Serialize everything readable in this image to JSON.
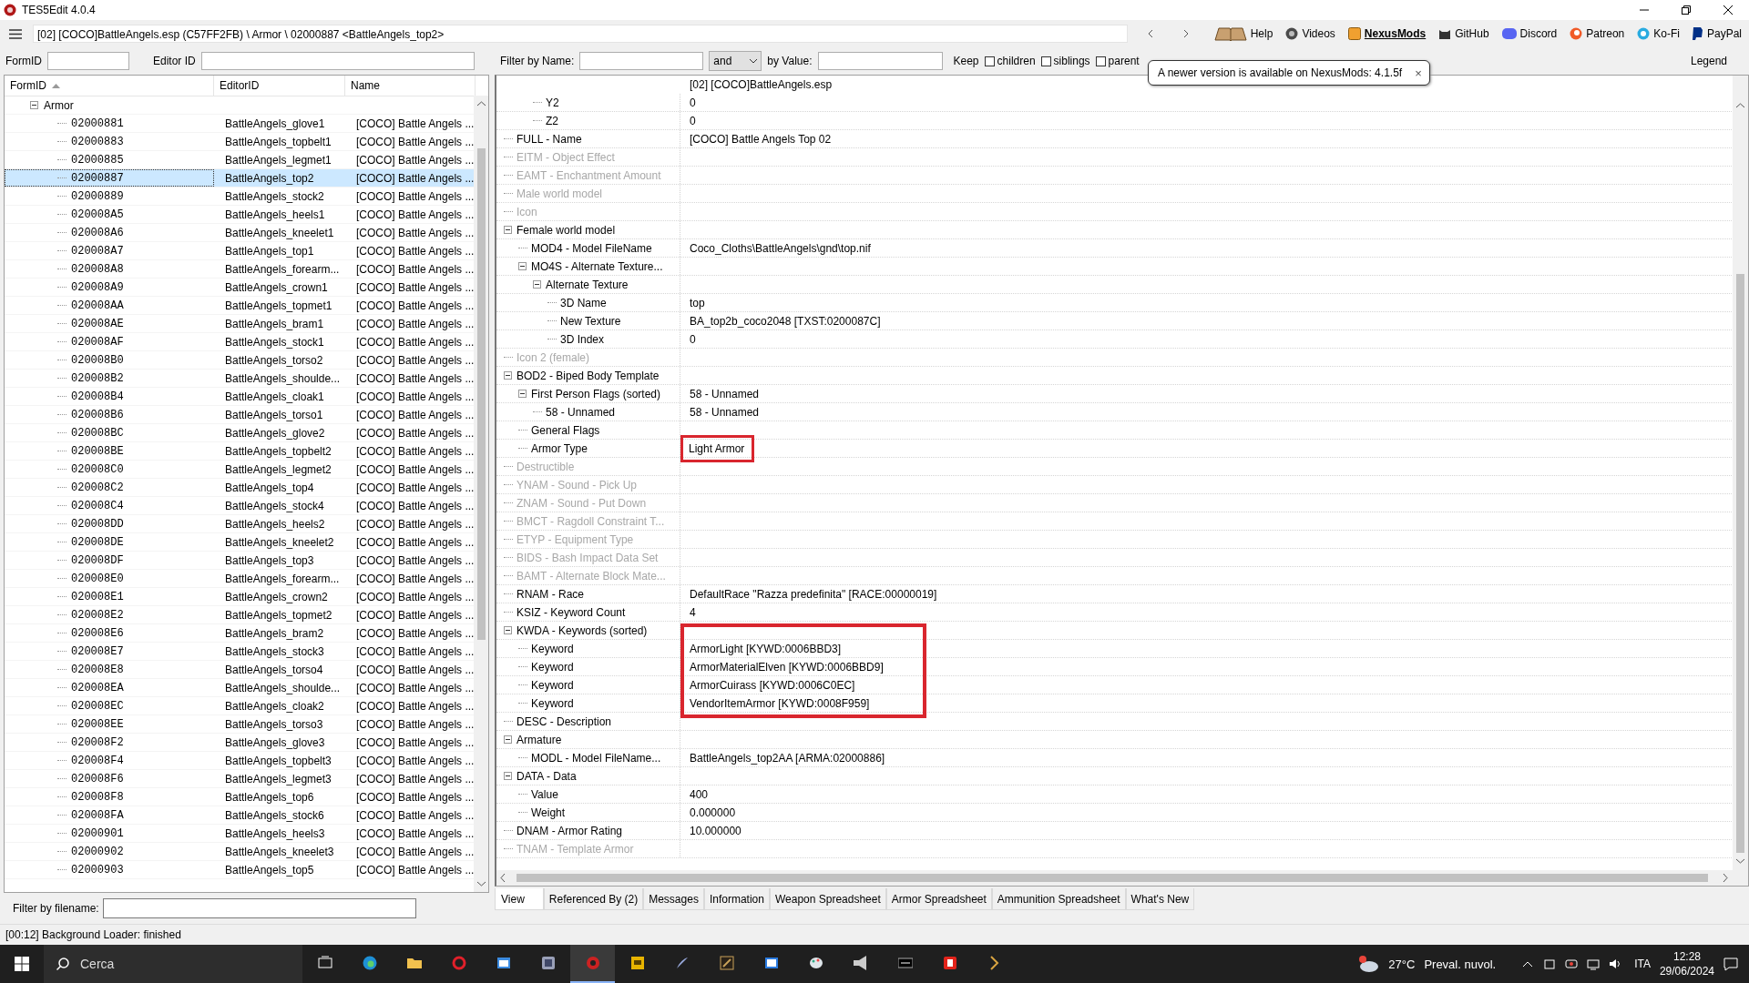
{
  "window": {
    "title": "TES5Edit 4.0.4"
  },
  "navbar": {
    "path": "[02] [COCO]BattleAngels.esp (C57FF2FB) \\ Armor \\ 02000887 <BattleAngels_top2>",
    "links": [
      {
        "label": "Help",
        "highlighted": false
      },
      {
        "label": "Videos",
        "highlighted": false
      },
      {
        "label": "NexusMods",
        "highlighted": true
      },
      {
        "label": "GitHub",
        "highlighted": false
      },
      {
        "label": "Discord",
        "highlighted": false
      },
      {
        "label": "Patreon",
        "highlighted": false
      },
      {
        "label": "Ko-Fi",
        "highlighted": false
      },
      {
        "label": "PayPal",
        "highlighted": false
      }
    ]
  },
  "left_filter": {
    "formid_label": "FormID",
    "editorid_label": "Editor ID"
  },
  "right_filter": {
    "name_label": "Filter by Name:",
    "operator": "and",
    "value_label": "by Value:",
    "keep_label": "Keep",
    "checkboxes": [
      {
        "label": "children",
        "checked": false
      },
      {
        "label": "siblings",
        "checked": false
      },
      {
        "label": "parent",
        "checked": false
      }
    ],
    "legend": "Legend"
  },
  "notification": {
    "text": "A newer version is available on NexusMods: 4.1.5f",
    "close": "×"
  },
  "records": {
    "columns": [
      "FormID",
      "EditorID",
      "Name"
    ],
    "group": {
      "label": "Armor",
      "expanded": true
    },
    "rows": [
      {
        "form_id": "02000881",
        "editor_id": "BattleAngels_glove1",
        "name": "[COCO] Battle Angels ...",
        "selected": false
      },
      {
        "form_id": "02000883",
        "editor_id": "BattleAngels_topbelt1",
        "name": "[COCO] Battle Angels ...",
        "selected": false
      },
      {
        "form_id": "02000885",
        "editor_id": "BattleAngels_legmet1",
        "name": "[COCO] Battle Angels ...",
        "selected": false
      },
      {
        "form_id": "02000887",
        "editor_id": "BattleAngels_top2",
        "name": "[COCO] Battle Angels ...",
        "selected": true
      },
      {
        "form_id": "02000889",
        "editor_id": "BattleAngels_stock2",
        "name": "[COCO] Battle Angels ...",
        "selected": false
      },
      {
        "form_id": "020008A5",
        "editor_id": "BattleAngels_heels1",
        "name": "[COCO] Battle Angels ...",
        "selected": false
      },
      {
        "form_id": "020008A6",
        "editor_id": "BattleAngels_kneelet1",
        "name": "[COCO] Battle Angels ...",
        "selected": false
      },
      {
        "form_id": "020008A7",
        "editor_id": "BattleAngels_top1",
        "name": "[COCO] Battle Angels ...",
        "selected": false
      },
      {
        "form_id": "020008A8",
        "editor_id": "BattleAngels_forearm...",
        "name": "[COCO] Battle Angels ...",
        "selected": false
      },
      {
        "form_id": "020008A9",
        "editor_id": "BattleAngels_crown1",
        "name": "[COCO] Battle Angels ...",
        "selected": false
      },
      {
        "form_id": "020008AA",
        "editor_id": "BattleAngels_topmet1",
        "name": "[COCO] Battle Angels ...",
        "selected": false
      },
      {
        "form_id": "020008AE",
        "editor_id": "BattleAngels_bram1",
        "name": "[COCO] Battle Angels ...",
        "selected": false
      },
      {
        "form_id": "020008AF",
        "editor_id": "BattleAngels_stock1",
        "name": "[COCO] Battle Angels ...",
        "selected": false
      },
      {
        "form_id": "020008B0",
        "editor_id": "BattleAngels_torso2",
        "name": "[COCO] Battle Angels ...",
        "selected": false
      },
      {
        "form_id": "020008B2",
        "editor_id": "BattleAngels_shoulde...",
        "name": "[COCO] Battle Angels ...",
        "selected": false
      },
      {
        "form_id": "020008B4",
        "editor_id": "BattleAngels_cloak1",
        "name": "[COCO] Battle Angels ...",
        "selected": false
      },
      {
        "form_id": "020008B6",
        "editor_id": "BattleAngels_torso1",
        "name": "[COCO] Battle Angels ...",
        "selected": false
      },
      {
        "form_id": "020008BC",
        "editor_id": "BattleAngels_glove2",
        "name": "[COCO] Battle Angels ...",
        "selected": false
      },
      {
        "form_id": "020008BE",
        "editor_id": "BattleAngels_topbelt2",
        "name": "[COCO] Battle Angels ...",
        "selected": false
      },
      {
        "form_id": "020008C0",
        "editor_id": "BattleAngels_legmet2",
        "name": "[COCO] Battle Angels ...",
        "selected": false
      },
      {
        "form_id": "020008C2",
        "editor_id": "BattleAngels_top4",
        "name": "[COCO] Battle Angels ...",
        "selected": false
      },
      {
        "form_id": "020008C4",
        "editor_id": "BattleAngels_stock4",
        "name": "[COCO] Battle Angels ...",
        "selected": false
      },
      {
        "form_id": "020008DD",
        "editor_id": "BattleAngels_heels2",
        "name": "[COCO] Battle Angels ...",
        "selected": false
      },
      {
        "form_id": "020008DE",
        "editor_id": "BattleAngels_kneelet2",
        "name": "[COCO] Battle Angels ...",
        "selected": false
      },
      {
        "form_id": "020008DF",
        "editor_id": "BattleAngels_top3",
        "name": "[COCO] Battle Angels ...",
        "selected": false
      },
      {
        "form_id": "020008E0",
        "editor_id": "BattleAngels_forearm...",
        "name": "[COCO] Battle Angels ...",
        "selected": false
      },
      {
        "form_id": "020008E1",
        "editor_id": "BattleAngels_crown2",
        "name": "[COCO] Battle Angels ...",
        "selected": false
      },
      {
        "form_id": "020008E2",
        "editor_id": "BattleAngels_topmet2",
        "name": "[COCO] Battle Angels ...",
        "selected": false
      },
      {
        "form_id": "020008E6",
        "editor_id": "BattleAngels_bram2",
        "name": "[COCO] Battle Angels ...",
        "selected": false
      },
      {
        "form_id": "020008E7",
        "editor_id": "BattleAngels_stock3",
        "name": "[COCO] Battle Angels ...",
        "selected": false
      },
      {
        "form_id": "020008E8",
        "editor_id": "BattleAngels_torso4",
        "name": "[COCO] Battle Angels ...",
        "selected": false
      },
      {
        "form_id": "020008EA",
        "editor_id": "BattleAngels_shoulde...",
        "name": "[COCO] Battle Angels ...",
        "selected": false
      },
      {
        "form_id": "020008EC",
        "editor_id": "BattleAngels_cloak2",
        "name": "[COCO] Battle Angels ...",
        "selected": false
      },
      {
        "form_id": "020008EE",
        "editor_id": "BattleAngels_torso3",
        "name": "[COCO] Battle Angels ...",
        "selected": false
      },
      {
        "form_id": "020008F2",
        "editor_id": "BattleAngels_glove3",
        "name": "[COCO] Battle Angels ...",
        "selected": false
      },
      {
        "form_id": "020008F4",
        "editor_id": "BattleAngels_topbelt3",
        "name": "[COCO] Battle Angels ...",
        "selected": false
      },
      {
        "form_id": "020008F6",
        "editor_id": "BattleAngels_legmet3",
        "name": "[COCO] Battle Angels ...",
        "selected": false
      },
      {
        "form_id": "020008F8",
        "editor_id": "BattleAngels_top6",
        "name": "[COCO] Battle Angels ...",
        "selected": false
      },
      {
        "form_id": "020008FA",
        "editor_id": "BattleAngels_stock6",
        "name": "[COCO] Battle Angels ...",
        "selected": false
      },
      {
        "form_id": "02000901",
        "editor_id": "BattleAngels_heels3",
        "name": "[COCO] Battle Angels ...",
        "selected": false
      },
      {
        "form_id": "02000902",
        "editor_id": "BattleAngels_kneelet3",
        "name": "[COCO] Battle Angels ...",
        "selected": false
      },
      {
        "form_id": "02000903",
        "editor_id": "BattleAngels_top5",
        "name": "[COCO] Battle Angels ...",
        "selected": false
      }
    ],
    "filename_filter_label": "Filter by filename:"
  },
  "record_view": {
    "file_header": "[02] [COCO]BattleAngels.esp",
    "continued_rows": [
      {
        "label": "Y2",
        "value": "0"
      },
      {
        "label": "Z2",
        "value": "0"
      }
    ],
    "fields": [
      {
        "label": "FULL - Name",
        "value": "[COCO] Battle Angels Top 02",
        "disabled": false
      },
      {
        "label": "EITM - Object Effect",
        "disabled": true
      },
      {
        "label": "EAMT - Enchantment Amount",
        "disabled": true
      },
      {
        "label": "Male world model",
        "disabled": true
      },
      {
        "label": "Icon",
        "disabled": true
      },
      {
        "label": "Female world model",
        "disabled": false,
        "expanded": true,
        "children": [
          {
            "label": "MOD4 - Model FileName",
            "value": "Coco_Cloths\\BattleAngels\\gnd\\top.nif",
            "disabled": false
          },
          {
            "label": "MO4S - Alternate Texture...",
            "disabled": false,
            "expanded": true,
            "children": [
              {
                "label": "Alternate Texture",
                "disabled": false,
                "expanded": true,
                "children": [
                  {
                    "label": "3D Name",
                    "value": "top",
                    "disabled": false
                  },
                  {
                    "label": "New Texture",
                    "value": "BA_top2b_coco2048 [TXST:0200087C]",
                    "disabled": false
                  },
                  {
                    "label": "3D Index",
                    "value": "0",
                    "disabled": false
                  }
                ]
              }
            ]
          }
        ]
      },
      {
        "label": "Icon 2 (female)",
        "disabled": true
      },
      {
        "label": "BOD2 - Biped Body Template",
        "disabled": false,
        "expanded": true,
        "children": [
          {
            "label": "First Person Flags (sorted)",
            "value": "58 - Unnamed",
            "disabled": false,
            "expanded": true,
            "children": [
              {
                "label": "58 - Unnamed",
                "value": "58 - Unnamed",
                "disabled": false
              }
            ]
          },
          {
            "label": "General Flags",
            "disabled": false
          },
          {
            "label": "Armor Type",
            "value": "Light Armor",
            "disabled": false,
            "outlined": true
          }
        ]
      },
      {
        "label": "Destructible",
        "disabled": true
      },
      {
        "label": "YNAM - Sound - Pick Up",
        "disabled": true
      },
      {
        "label": "ZNAM - Sound - Put Down",
        "disabled": true
      },
      {
        "label": "BMCT - Ragdoll Constraint T...",
        "disabled": true
      },
      {
        "label": "ETYP - Equipment Type",
        "disabled": true
      },
      {
        "label": "BIDS - Bash Impact Data Set",
        "disabled": true
      },
      {
        "label": "BAMT - Alternate Block Mate...",
        "disabled": true
      },
      {
        "label": "RNAM - Race",
        "value": "DefaultRace \"Razza predefinita\" [RACE:00000019]",
        "disabled": false
      },
      {
        "label": "KSIZ - Keyword Count",
        "value": "4",
        "disabled": false
      },
      {
        "label": "KWDA - Keywords (sorted)",
        "disabled": false,
        "expanded": true,
        "outlined": true,
        "children": [
          {
            "label": "Keyword",
            "value": "ArmorLight [KYWD:0006BBD3]",
            "disabled": false
          },
          {
            "label": "Keyword",
            "value": "ArmorMaterialElven [KYWD:0006BBD9]",
            "disabled": false
          },
          {
            "label": "Keyword",
            "value": "ArmorCuirass [KYWD:0006C0EC]",
            "disabled": false
          },
          {
            "label": "Keyword",
            "value": "VendorItemArmor [KYWD:0008F959]",
            "disabled": false
          }
        ]
      },
      {
        "label": "DESC - Description",
        "disabled": false
      },
      {
        "label": "Armature",
        "disabled": false,
        "expanded": true,
        "children": [
          {
            "label": "MODL - Model FileName...",
            "value": "BattleAngels_top2AA [ARMA:02000886]",
            "disabled": false
          }
        ]
      },
      {
        "label": "DATA - Data",
        "disabled": false,
        "expanded": true,
        "children": [
          {
            "label": "Value",
            "value": "400",
            "disabled": false
          },
          {
            "label": "Weight",
            "value": "0.000000",
            "disabled": false
          }
        ]
      },
      {
        "label": "DNAM - Armor Rating",
        "value": "10.000000",
        "disabled": false
      },
      {
        "label": "TNAM - Template Armor",
        "disabled": true
      }
    ],
    "tabs": [
      {
        "label": "View",
        "selected": true
      },
      {
        "label": "Referenced By (2)",
        "selected": false
      },
      {
        "label": "Messages",
        "selected": false
      },
      {
        "label": "Information",
        "selected": false
      },
      {
        "label": "Weapon Spreadsheet",
        "selected": false
      },
      {
        "label": "Armor Spreadsheet",
        "selected": false
      },
      {
        "label": "Ammunition Spreadsheet",
        "selected": false
      },
      {
        "label": "What's New",
        "selected": false
      }
    ]
  },
  "status_bar": "[00:12] Background Loader: finished",
  "taskbar": {
    "search": {
      "placeholder": "Cerca"
    },
    "apps": [
      {
        "selected": false
      },
      {
        "selected": false
      },
      {
        "selected": false
      },
      {
        "selected": false
      },
      {
        "selected": false
      },
      {
        "selected": false
      },
      {
        "selected": true
      },
      {
        "selected": false
      },
      {
        "selected": false
      },
      {
        "selected": false
      },
      {
        "selected": false
      },
      {
        "selected": false
      },
      {
        "selected": false
      },
      {
        "selected": false
      },
      {
        "selected": false
      },
      {
        "selected": false
      }
    ],
    "weather": {
      "temperature": "27°C",
      "condition": "Preval. nuvol."
    },
    "language": "ITA",
    "time": "12:28",
    "date": "29/06/2024"
  }
}
